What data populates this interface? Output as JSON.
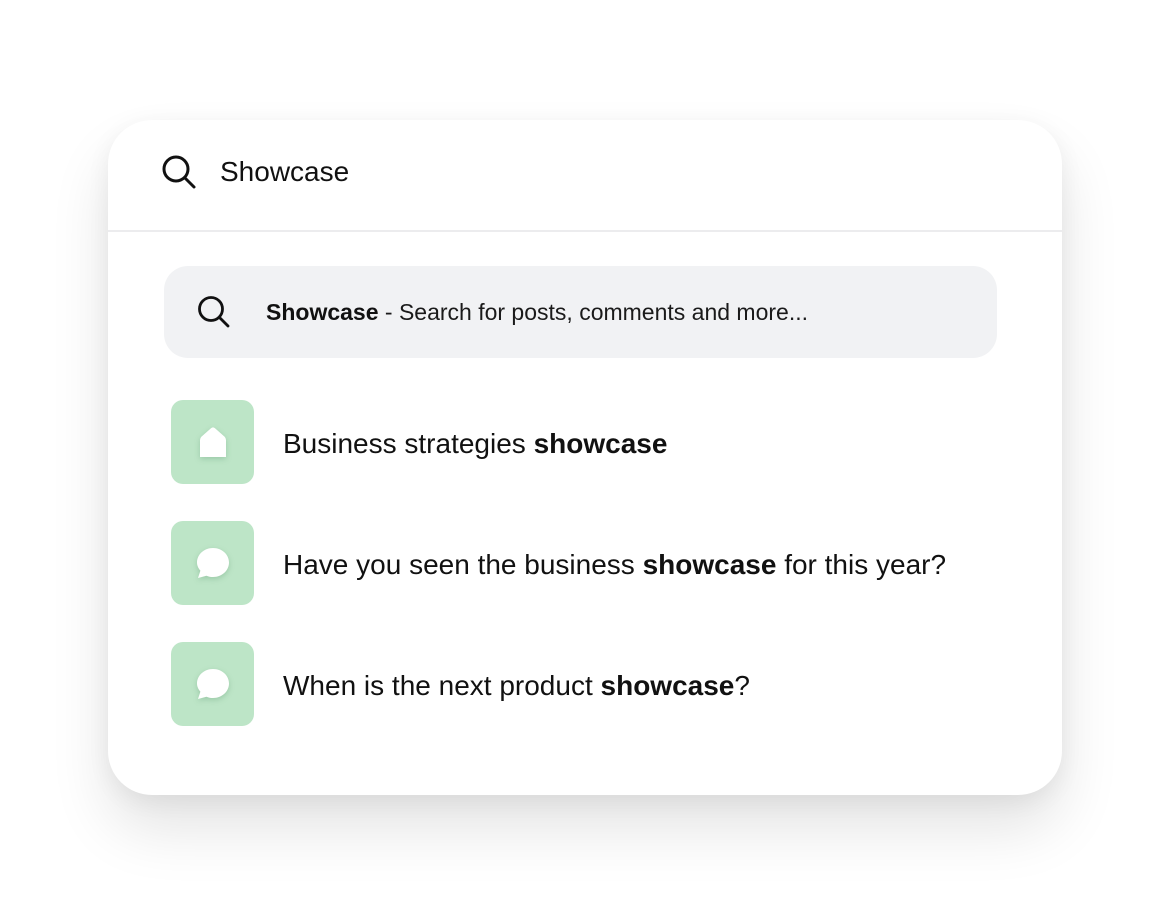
{
  "search": {
    "value": "Showcase",
    "icon": "search-icon"
  },
  "suggestion": {
    "term": "Showcase",
    "hint": " - Search for posts, comments and more...",
    "icon": "search-icon"
  },
  "results": [
    {
      "icon": "home-icon",
      "before": "Business strategies ",
      "bold": "showcase",
      "after": ""
    },
    {
      "icon": "chat-bubble-icon",
      "before": "Have you seen the business ",
      "bold": "showcase",
      "after": " for this year?"
    },
    {
      "icon": "chat-bubble-icon",
      "before": "When is the next product ",
      "bold": "showcase",
      "after": "?"
    }
  ],
  "colors": {
    "tile": "#bde5c7",
    "suggestion_bg": "#f1f2f4",
    "text": "#111111"
  }
}
